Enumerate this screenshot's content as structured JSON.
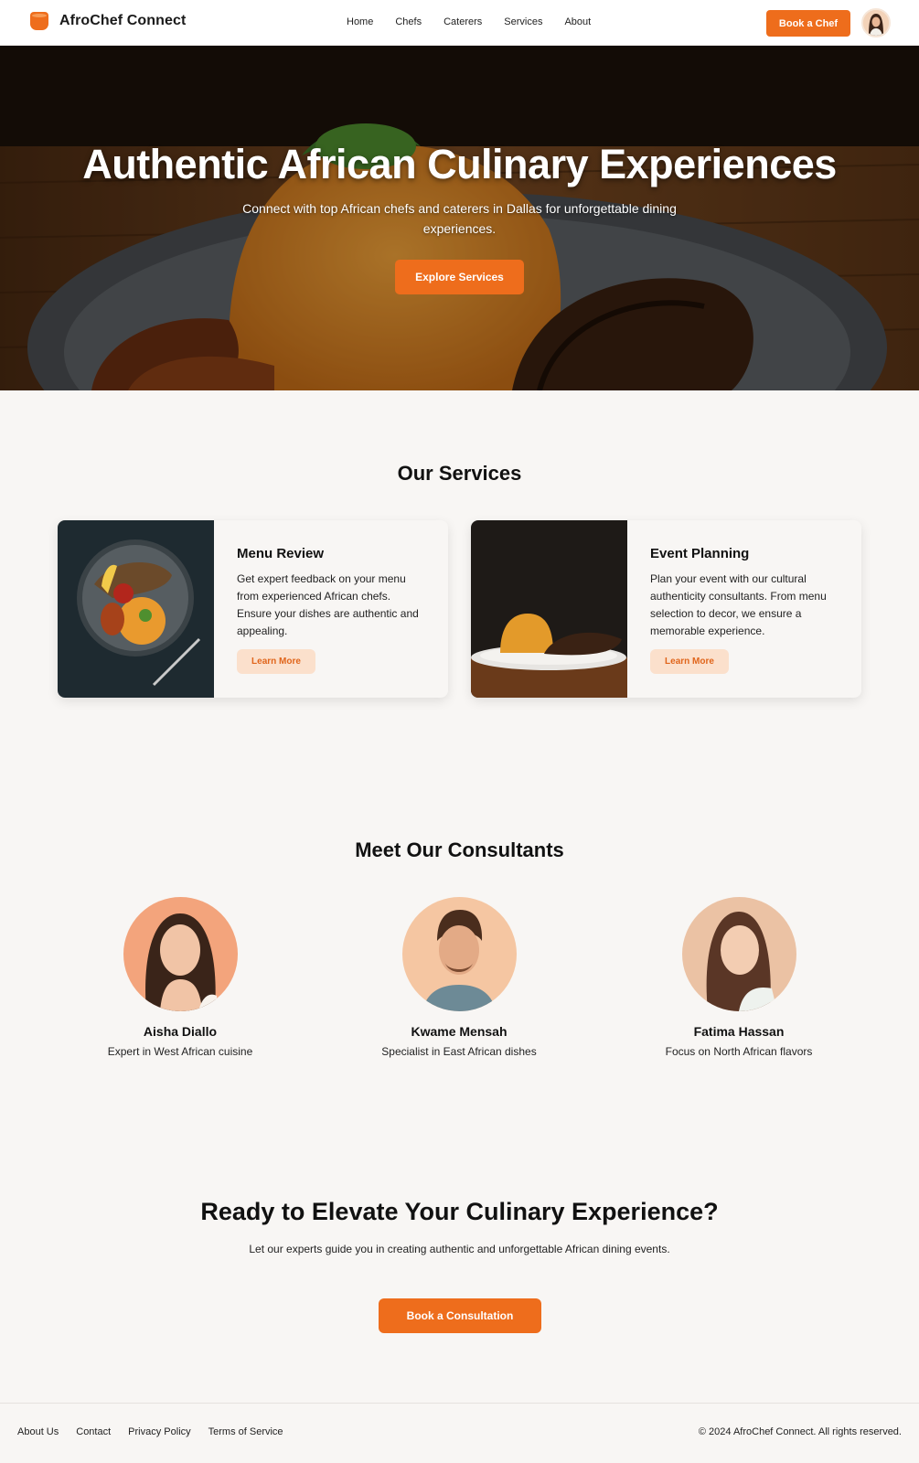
{
  "nav": {
    "brand": "AfroChef Connect",
    "brand_icon": "cooking-pot-icon",
    "links": [
      "Home",
      "Chefs",
      "Caterers",
      "Services",
      "About"
    ],
    "cta": "Book a Chef",
    "accent": "#ee6d1c"
  },
  "hero": {
    "title": "Authentic African Culinary Experiences",
    "subtitle": "Connect with top African chefs and caterers in Dallas for unforgettable dining experiences.",
    "button": "Explore Services"
  },
  "services": {
    "title": "Our Services",
    "items": [
      {
        "title": "Menu Review",
        "text": "Get expert feedback on your menu from experienced African chefs. Ensure your dishes are authentic and appealing.",
        "button": "Learn More"
      },
      {
        "title": "Event Planning",
        "text": "Plan your event with our cultural authenticity consultants. From menu selection to decor, we ensure a memorable experience.",
        "button": "Learn More"
      }
    ]
  },
  "consultants": {
    "title": "Meet Our Consultants",
    "people": [
      {
        "name": "Aisha Diallo",
        "role": "Expert in West African cuisine"
      },
      {
        "name": "Kwame Mensah",
        "role": "Specialist in East African dishes"
      },
      {
        "name": "Fatima Hassan",
        "role": "Focus on North African flavors"
      }
    ]
  },
  "cta": {
    "title": "Ready to Elevate Your Culinary Experience?",
    "text": "Let our experts guide you in creating authentic and unforgettable African dining events.",
    "button": "Book a Consultation"
  },
  "footer": {
    "links": [
      "About Us",
      "Contact",
      "Privacy Policy",
      "Terms of Service"
    ],
    "copyright": "© 2024 AfroChef Connect. All rights reserved."
  }
}
